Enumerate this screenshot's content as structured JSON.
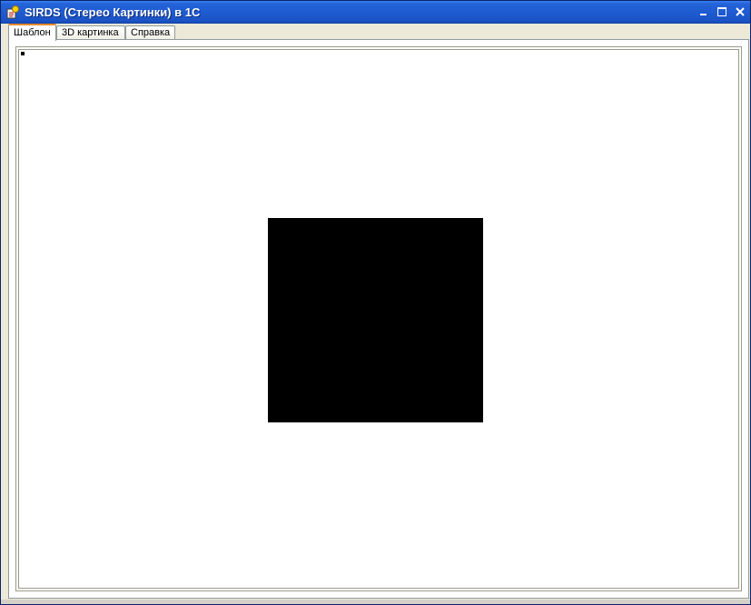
{
  "window": {
    "title": "SIRDS (Стерео Картинки) в 1С",
    "icon": "1c-app-icon",
    "accent_color": "#1f5bd1"
  },
  "titlebar_controls": {
    "minimize_icon": "minimize-icon",
    "maximize_icon": "maximize-icon",
    "close_icon": "close-icon"
  },
  "tabs": [
    {
      "label": "Шаблон",
      "active": true
    },
    {
      "label": "3D картинка",
      "active": false
    },
    {
      "label": "Справка",
      "active": false
    }
  ],
  "canvas": {
    "background_color": "#ffffff",
    "shape_color": "#000000"
  }
}
